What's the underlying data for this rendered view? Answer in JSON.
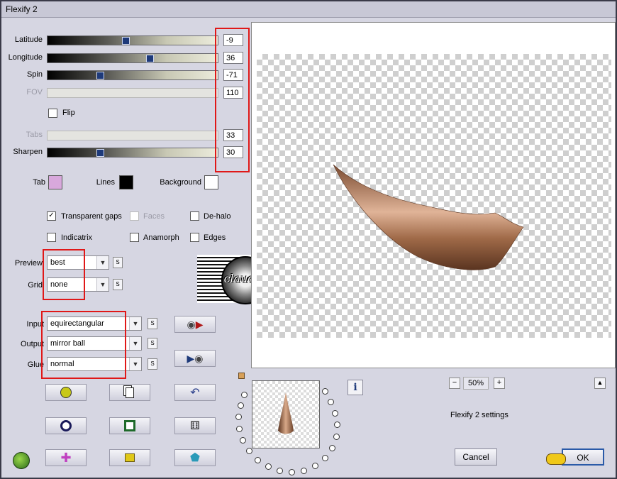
{
  "window": {
    "title": "Flexify 2"
  },
  "sliders": [
    {
      "label": "Latitude",
      "value": "-9",
      "level": 0.46,
      "enabled": true
    },
    {
      "label": "Longitude",
      "value": "36",
      "level": 0.6,
      "enabled": true
    },
    {
      "label": "Spin",
      "value": "-71",
      "level": 0.31,
      "enabled": true
    },
    {
      "label": "FOV",
      "value": "110",
      "level": null,
      "enabled": false
    },
    {
      "label": "Tabs",
      "value": "33",
      "level": null,
      "enabled": false
    },
    {
      "label": "Sharpen",
      "value": "30",
      "level": 0.31,
      "enabled": true
    }
  ],
  "flip": {
    "label": "Flip",
    "checked": false
  },
  "colors": {
    "tab": {
      "label": "Tab",
      "color": "#d8a8dc"
    },
    "lines": {
      "label": "Lines",
      "color": "#000000"
    },
    "background": {
      "label": "Background",
      "color": "#ffffff"
    }
  },
  "options": [
    {
      "label": "Transparent gaps",
      "checked": true,
      "enabled": true
    },
    {
      "label": "Faces",
      "checked": false,
      "enabled": false
    },
    {
      "label": "De-halo",
      "checked": false,
      "enabled": true
    },
    {
      "label": "Indicatrix",
      "checked": false,
      "enabled": true
    },
    {
      "label": "Anamorph",
      "checked": false,
      "enabled": true
    },
    {
      "label": "Edges",
      "checked": false,
      "enabled": true
    }
  ],
  "dropdowns": {
    "preview": {
      "label": "Preview",
      "value": "best"
    },
    "grid": {
      "label": "Grid",
      "value": "none"
    },
    "input": {
      "label": "Input",
      "value": "equirectangular"
    },
    "output": {
      "label": "Output",
      "value": "mirror ball"
    },
    "glue": {
      "label": "Glue",
      "value": "normal"
    }
  },
  "sbutton_label": "S",
  "watermark": {
    "text": "claudia"
  },
  "zoom": {
    "value": "50%",
    "minus": "−",
    "plus": "+"
  },
  "info": {
    "text": "Flexify 2 settings",
    "icon": "i"
  },
  "buttons": {
    "cancel": "Cancel",
    "ok": "OK"
  },
  "accent": {
    "highlight": "#e01818",
    "shape": "#b07a55"
  }
}
